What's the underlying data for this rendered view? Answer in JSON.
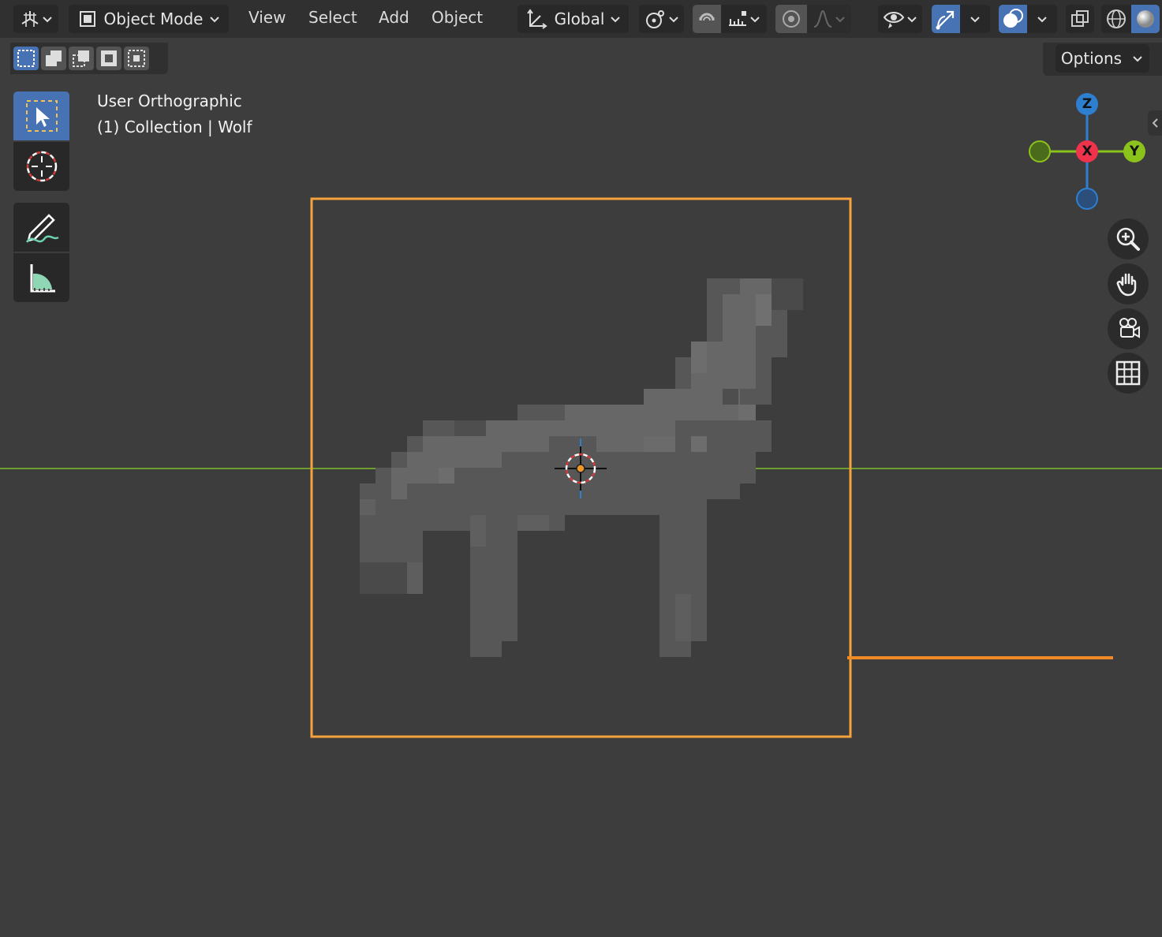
{
  "header": {
    "editor_type_icon": "editor-type-3d-viewport-icon",
    "mode": {
      "icon": "object-mode-icon",
      "label": "Object Mode"
    },
    "menus": [
      "View",
      "Select",
      "Add",
      "Object"
    ],
    "transform_orientation": {
      "icon": "orientation-axes-icon",
      "label": "Global"
    },
    "pivot_icon": "pivot-point-icon",
    "snap_icon": "magnet-snap-icon",
    "snap_target_icon": "snap-increment-icon",
    "proportional_edit_icon": "proportional-edit-icon",
    "falloff_icon": "falloff-curve-icon",
    "visibility_icon": "eye-visibility-icon",
    "gizmo_icon": "gizmo-toggle-icon",
    "overlay_icon": "overlay-toggle-icon",
    "xray_icon": "xray-toggle-icon",
    "shading_wireframe_icon": "wireframe-shading-icon",
    "shading_solid_icon": "solid-shading-icon"
  },
  "selection_modes": [
    "select-new-icon",
    "select-extend-icon",
    "select-subtract-icon",
    "select-invert-icon",
    "select-intersect-icon"
  ],
  "options_label": "Options",
  "toolbar": {
    "tools": [
      "select-box-icon",
      "cursor-icon",
      "annotate-icon",
      "measure-icon"
    ]
  },
  "viewport": {
    "view_name": "User Orthographic",
    "collection_prefix": "(1) Collection",
    "object_name": "Wolf",
    "separator": "|"
  },
  "gizmo": {
    "labels": {
      "z": "Z",
      "x": "X",
      "y": "Y"
    },
    "colors": {
      "z": "#2f7fd1",
      "x": "#f0334c",
      "y": "#8bc21c"
    }
  },
  "nav_controls": [
    "zoom-icon",
    "pan-hand-icon",
    "camera-view-icon",
    "ortho-grid-icon"
  ],
  "colors": {
    "selection_outline": "#f5a33c",
    "y_axis_line": "#6f9e2f",
    "accent_blue": "#4772b3"
  }
}
